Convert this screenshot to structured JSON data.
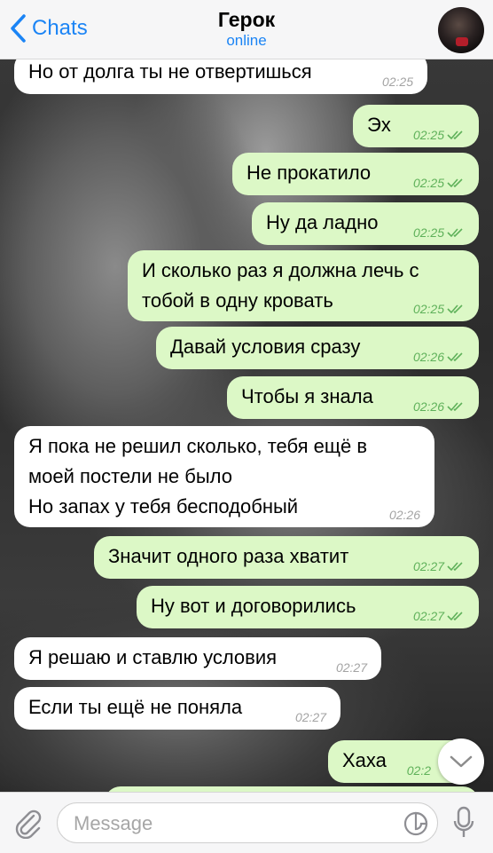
{
  "header": {
    "back_label": "Chats",
    "title": "Герок",
    "status": "online",
    "avatar_icon": "avatar"
  },
  "messages": [
    {
      "dir": "in",
      "lines": [
        "Но от долга ты не отвертишься"
      ],
      "time": "02:25"
    },
    {
      "dir": "out",
      "lines": [
        "Эх"
      ],
      "time": "02:25"
    },
    {
      "dir": "out",
      "lines": [
        "Не прокатило"
      ],
      "time": "02:25"
    },
    {
      "dir": "out",
      "lines": [
        "Ну да ладно"
      ],
      "time": "02:25"
    },
    {
      "dir": "out",
      "lines": [
        "И сколько раз я должна лечь с",
        "тобой в одну кровать"
      ],
      "time": "02:25"
    },
    {
      "dir": "out",
      "lines": [
        "Давай условия сразу"
      ],
      "time": "02:26"
    },
    {
      "dir": "out",
      "lines": [
        "Чтобы я знала"
      ],
      "time": "02:26"
    },
    {
      "dir": "in",
      "lines": [
        "Я пока не решил сколько, тебя ещё в",
        "моей постели не было",
        "Но запах у тебя бесподобный"
      ],
      "time": "02:26"
    },
    {
      "dir": "out",
      "lines": [
        "Значит одного раза хватит"
      ],
      "time": "02:27"
    },
    {
      "dir": "out",
      "lines": [
        "Ну вот и договорились"
      ],
      "time": "02:27"
    },
    {
      "dir": "in",
      "lines": [
        "Я решаю и ставлю условия"
      ],
      "time": "02:27"
    },
    {
      "dir": "in",
      "lines": [
        "Если ты ещё не поняла"
      ],
      "time": "02:27"
    },
    {
      "dir": "out",
      "lines": [
        "Хаха"
      ],
      "time": "02:2"
    }
  ],
  "input": {
    "placeholder": "Message"
  },
  "colors": {
    "accent": "#1b84f5",
    "outgoing_bubble": "#dcf8c6",
    "incoming_bubble": "#ffffff",
    "check_color": "#5fb15a"
  },
  "icons": {
    "back": "chevron-left-icon",
    "attach": "paperclip-icon",
    "sticker": "sticker-icon",
    "mic": "microphone-icon",
    "scroll": "chevron-down-icon",
    "read": "double-check-icon"
  }
}
